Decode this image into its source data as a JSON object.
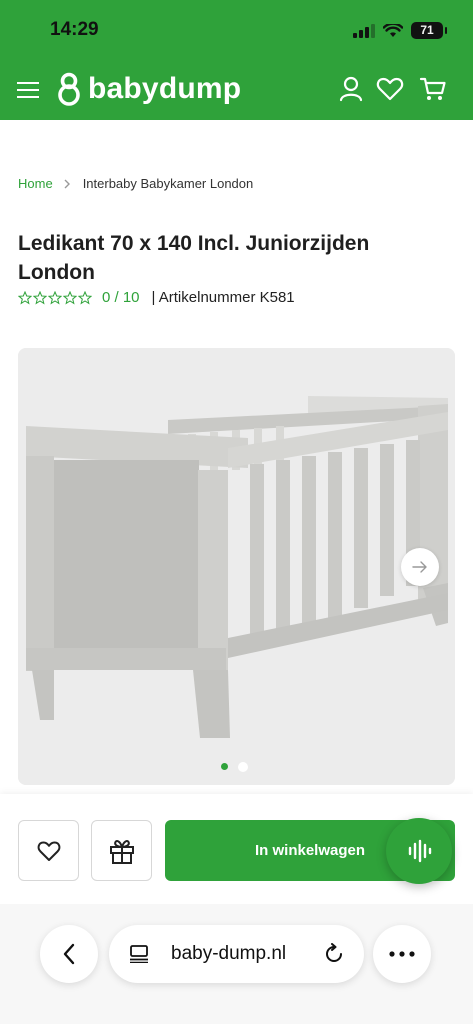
{
  "status_bar": {
    "time": "14:29",
    "battery": "71"
  },
  "header": {
    "brand": "babydump",
    "icons": [
      "menu-icon",
      "account-icon",
      "heart-icon",
      "cart-icon"
    ]
  },
  "breadcrumb": {
    "home": "Home",
    "current": "Interbaby Babykamer London"
  },
  "product": {
    "title": "Ledikant 70 x 140 Incl. Juniorzijden London",
    "rating": "0 / 10",
    "article_number": "| Artikelnummer  K581",
    "stars_total": 5
  },
  "gallery": {
    "images": 2,
    "active_index": 0
  },
  "actions": {
    "cart_label": "In winkelwagen"
  },
  "browser": {
    "url": "baby-dump.nl"
  },
  "colors": {
    "brand_green": "#2fa23a"
  }
}
